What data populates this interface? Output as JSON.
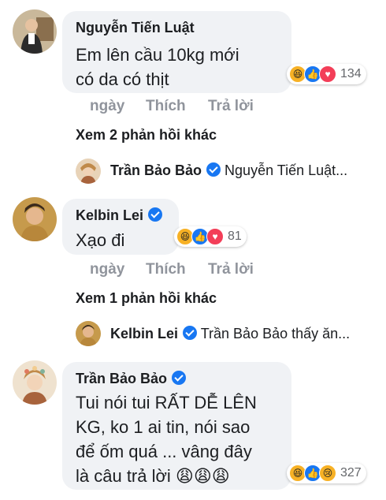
{
  "comments": [
    {
      "author": "Nguyễn Tiến Luật",
      "lines": [
        "Em lên cầu 10kg mới",
        "có da có thịt"
      ],
      "reactions": {
        "icons": [
          "haha-icon",
          "like-icon",
          "love-icon"
        ],
        "count": "134"
      },
      "actions": {
        "time": "ngày",
        "like": "Thích",
        "reply": "Trả lời"
      },
      "more_replies": "Xem 2 phản hồi khác",
      "reply_preview": {
        "author": "Trần Bảo Bảo",
        "text": "Nguyễn Tiến Luật..."
      }
    },
    {
      "author": "Kelbin Lei",
      "lines": [
        "Xạo đi"
      ],
      "reactions": {
        "icons": [
          "haha-icon",
          "like-icon",
          "love-icon"
        ],
        "count": "81"
      },
      "actions": {
        "time": "ngày",
        "like": "Thích",
        "reply": "Trả lời"
      },
      "more_replies": "Xem 1 phản hồi khác",
      "reply_preview": {
        "author": "Kelbin Lei",
        "text": "Trần Bảo Bảo thấy ăn..."
      }
    },
    {
      "author": "Trần Bảo Bảo",
      "lines": [
        "Tui nói tui RẤT DỄ LÊN",
        "KG, ko 1 ai tin, nói sao",
        "để ốm quá ... vâng đây",
        "là câu trả lời 😩😩😩"
      ],
      "reactions": {
        "icons": [
          "haha-icon",
          "like-icon",
          "sad-icon"
        ],
        "count": "327"
      }
    }
  ],
  "colors": {
    "bubble": "#f0f2f5",
    "verified": "#1877f2",
    "action_text": "#90949c",
    "haha": "#f7b125",
    "love": "#f33e58",
    "like": "#1877f2"
  }
}
